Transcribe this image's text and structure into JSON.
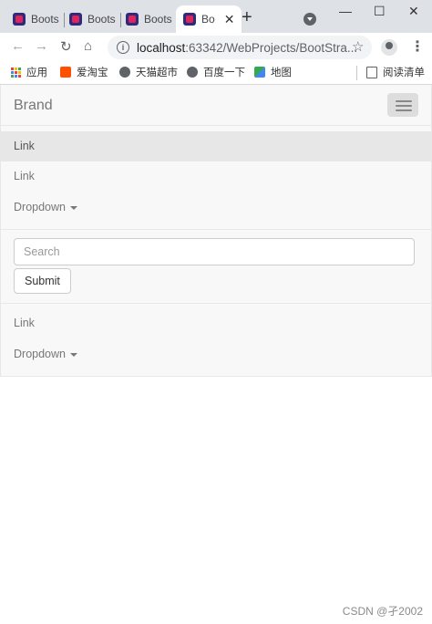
{
  "browser": {
    "tabs": [
      {
        "label": "Boots"
      },
      {
        "label": "Boots"
      },
      {
        "label": "Boots"
      },
      {
        "label": "Bo",
        "active": true
      }
    ],
    "new_tab_symbol": "+",
    "window_controls": {
      "minimize": "—",
      "maximize": "☐",
      "close": "✕"
    },
    "address": {
      "host": "localhost",
      "path": ":63342/WebProjects/BootStra..."
    },
    "bookmarks": [
      {
        "label": "应用",
        "icon": "apps-icon"
      },
      {
        "label": "爱淘宝",
        "icon": "taobao-icon"
      },
      {
        "label": "天猫超市",
        "icon": "globe-icon"
      },
      {
        "label": "百度一下",
        "icon": "globe-icon"
      },
      {
        "label": "地图",
        "icon": "maps-icon"
      }
    ],
    "reading_list": "阅读清单"
  },
  "navbar": {
    "brand": "Brand",
    "links_top": [
      {
        "label": "Link",
        "active": true
      },
      {
        "label": "Link",
        "active": false
      }
    ],
    "dropdown_top": "Dropdown",
    "search_placeholder": "Search",
    "submit_label": "Submit",
    "links_bottom": [
      {
        "label": "Link"
      }
    ],
    "dropdown_bottom": "Dropdown"
  },
  "watermark": "CSDN @孑2002",
  "colors": {
    "navbar_bg": "#f8f8f8",
    "navbar_border": "#e7e7e7",
    "active_link_bg": "#e7e7e7",
    "link_text": "#777777",
    "tabbar_bg": "#dee1e6"
  }
}
